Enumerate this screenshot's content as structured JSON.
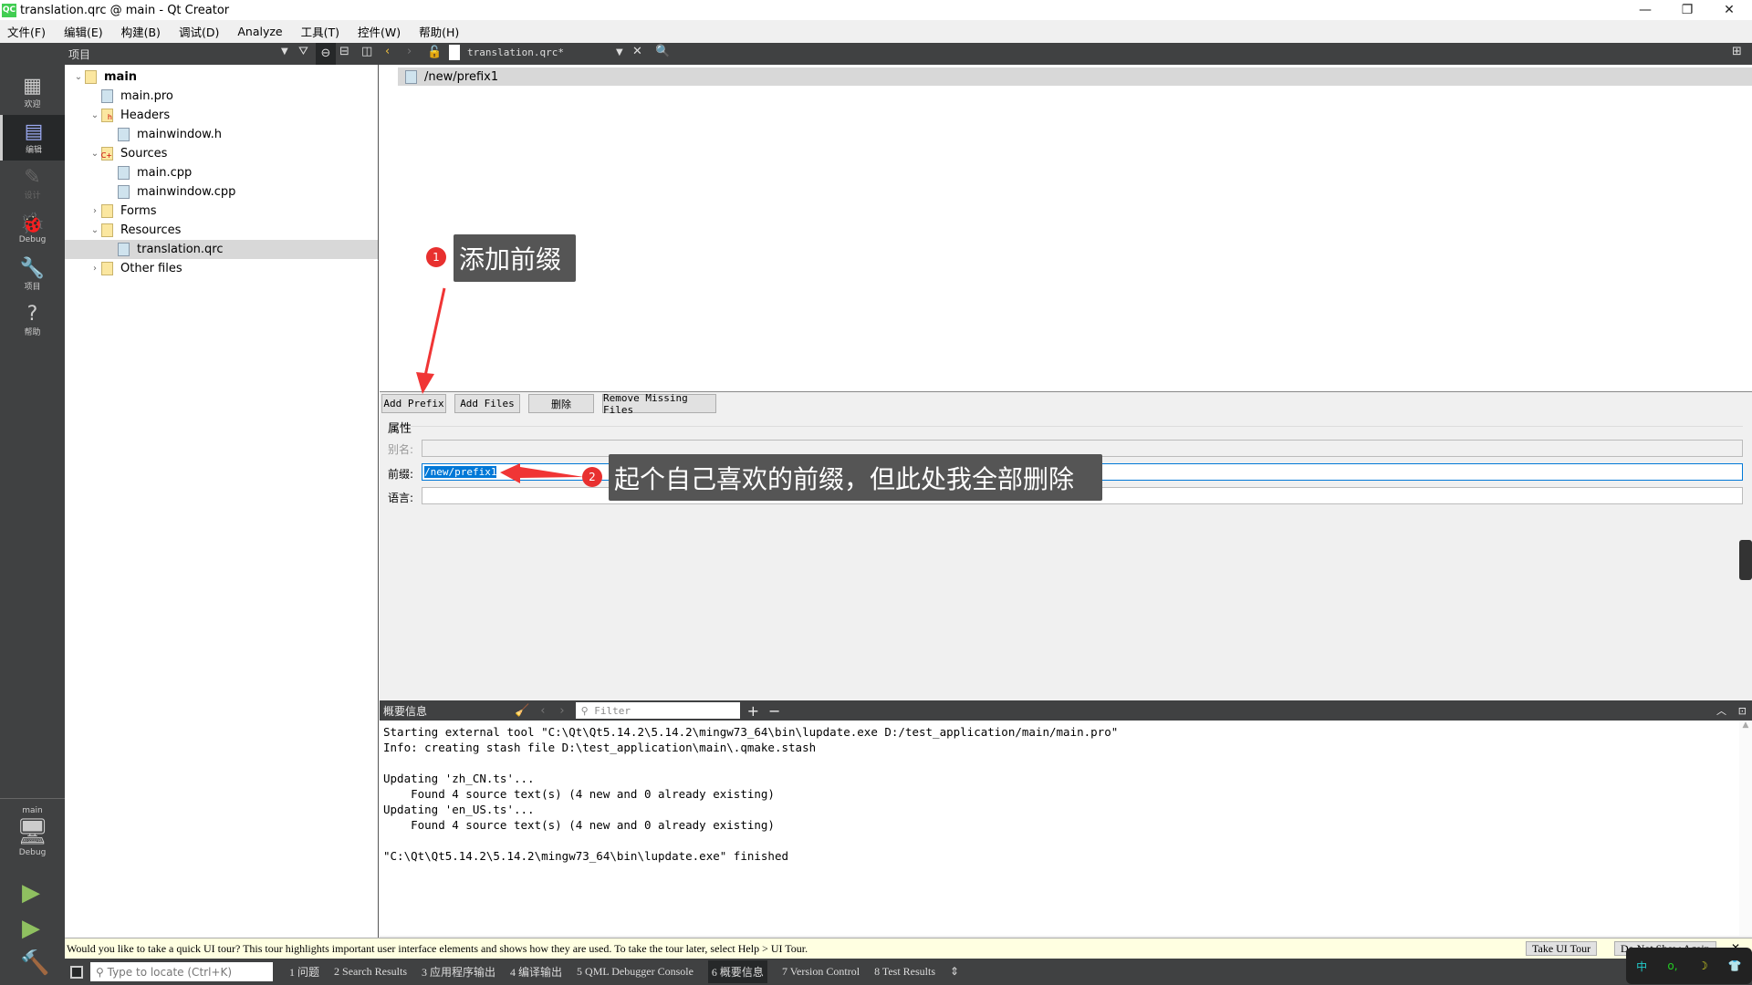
{
  "window": {
    "title": "translation.qrc @ main - Qt Creator",
    "logo": "QC"
  },
  "menu": [
    "文件(F)",
    "编辑(E)",
    "构建(B)",
    "调试(D)",
    "Analyze",
    "工具(T)",
    "控件(W)",
    "帮助(H)"
  ],
  "modes": [
    {
      "label": "欢迎",
      "icon": "grid-icon"
    },
    {
      "label": "编辑",
      "icon": "edit-icon"
    },
    {
      "label": "设计",
      "icon": "pencil-icon"
    },
    {
      "label": "Debug",
      "icon": "bug-icon"
    },
    {
      "label": "项目",
      "icon": "wrench-icon"
    },
    {
      "label": "帮助",
      "icon": "help-icon"
    }
  ],
  "kit": {
    "project": "main",
    "config": "Debug"
  },
  "project_panel": {
    "title": "项目",
    "tree": [
      {
        "label": "main",
        "level": 0,
        "expanded": true,
        "bold": true
      },
      {
        "label": "main.pro",
        "level": 1
      },
      {
        "label": "Headers",
        "level": 1,
        "expanded": true,
        "folder": true,
        "badge": "h"
      },
      {
        "label": "mainwindow.h",
        "level": 2
      },
      {
        "label": "Sources",
        "level": 1,
        "expanded": true,
        "folder": true,
        "badge": "C+"
      },
      {
        "label": "main.cpp",
        "level": 2
      },
      {
        "label": "mainwindow.cpp",
        "level": 2
      },
      {
        "label": "Forms",
        "level": 1,
        "expanded": false,
        "folder": true
      },
      {
        "label": "Resources",
        "level": 1,
        "expanded": true,
        "folder": true
      },
      {
        "label": "translation.qrc",
        "level": 2,
        "selected": true
      },
      {
        "label": "Other files",
        "level": 1,
        "expanded": false,
        "folder": true
      }
    ]
  },
  "editor": {
    "file_tab": "translation.qrc*",
    "prefix_item": "/new/prefix1",
    "buttons": {
      "add_prefix": "Add Prefix",
      "add_files": "Add Files",
      "delete": "删除",
      "remove_missing": "Remove Missing Files"
    },
    "properties": {
      "title": "属性",
      "alias_label": "别名:",
      "alias_value": "",
      "prefix_label": "前缀:",
      "prefix_value": "/new/prefix1",
      "language_label": "语言:",
      "language_value": ""
    }
  },
  "annotations": {
    "n1": "1",
    "text1": "添加前缀",
    "n2": "2",
    "text2": "起个自己喜欢的前缀，但此处我全部删除"
  },
  "output": {
    "title": "概要信息",
    "filter_placeholder": "Filter",
    "lines": [
      "Starting external tool \"C:\\Qt\\Qt5.14.2\\5.14.2\\mingw73_64\\bin\\lupdate.exe D:/test_application/main/main.pro\"",
      "Info: creating stash file D:\\test_application\\main\\.qmake.stash",
      "",
      "Updating 'zh_CN.ts'...",
      "    Found 4 source text(s) (4 new and 0 already existing)",
      "Updating 'en_US.ts'...",
      "    Found 4 source text(s) (4 new and 0 already existing)",
      "",
      "\"C:\\Qt\\Qt5.14.2\\5.14.2\\mingw73_64\\bin\\lupdate.exe\" finished"
    ]
  },
  "tour": {
    "message": "Would you like to take a quick UI tour? This tour highlights important user interface elements and shows how they are used. To take the tour later, select Help > UI Tour.",
    "take": "Take UI Tour",
    "dismiss": "Do Not Show Again"
  },
  "bottom": {
    "locate_placeholder": "Type to locate (Ctrl+K)",
    "tabs": [
      "1 问题",
      "2 Search Results",
      "3 应用程序输出",
      "4 编译输出",
      "5 QML Debugger Console",
      "6 概要信息",
      "7 Version Control",
      "8 Test Results"
    ],
    "active_tab": 5
  },
  "ime": [
    "中",
    "o,",
    "☽",
    "👕"
  ]
}
